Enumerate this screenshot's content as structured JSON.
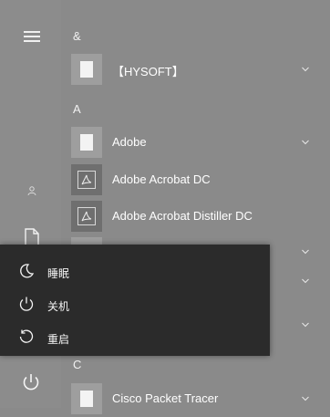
{
  "sidebar": {
    "menu_icon": "hamburger-icon",
    "user_icon": "user-icon",
    "documents_icon": "document-icon",
    "power_icon": "power-icon"
  },
  "app_list": {
    "groups": [
      {
        "letter": "&",
        "apps": [
          {
            "label": "【HYSOFT】",
            "icon": "folder-icon",
            "expandable": true
          }
        ]
      },
      {
        "letter": "A",
        "apps": [
          {
            "label": "Adobe",
            "icon": "folder-icon",
            "expandable": true
          },
          {
            "label": "Adobe Acrobat DC",
            "icon": "acrobat-icon",
            "expandable": false
          },
          {
            "label": "Adobe Acrobat Distiller DC",
            "icon": "acrobat-icon",
            "expandable": false
          }
        ]
      },
      {
        "letter": "C",
        "apps": [
          {
            "label": "Cisco Packet Tracer",
            "icon": "folder-icon",
            "expandable": true
          }
        ]
      }
    ]
  },
  "power_menu": {
    "items": [
      {
        "label": "睡眠",
        "icon": "sleep-icon"
      },
      {
        "label": "关机",
        "icon": "shutdown-icon"
      },
      {
        "label": "重启",
        "icon": "restart-icon"
      }
    ]
  },
  "colors": {
    "background": "#8a8a8a",
    "power_menu_bg": "#2b2b2b",
    "text": "#ffffff"
  }
}
